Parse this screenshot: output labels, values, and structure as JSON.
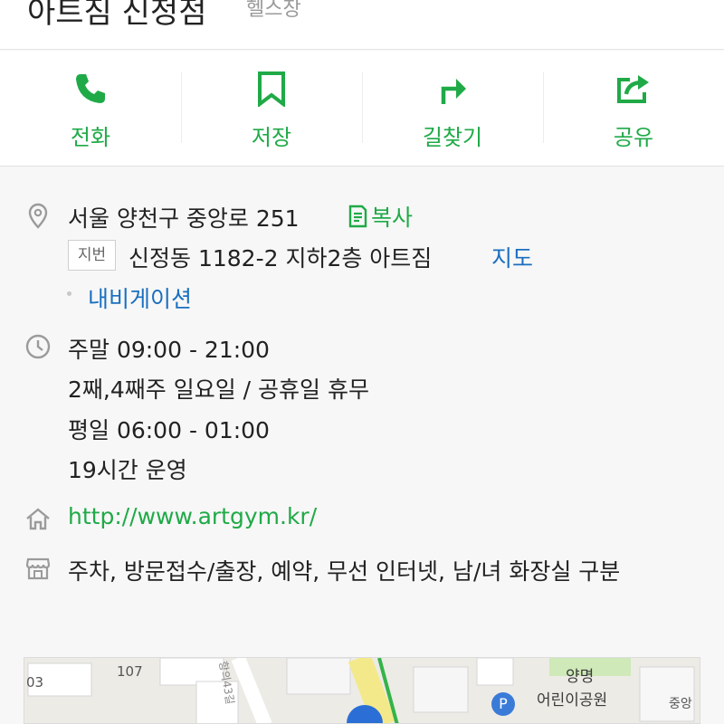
{
  "header": {
    "name": "아트짐 신정점",
    "category": "헬스장"
  },
  "actions": [
    {
      "label": "전화",
      "icon": "phone-icon"
    },
    {
      "label": "저장",
      "icon": "bookmark-icon"
    },
    {
      "label": "길찾기",
      "icon": "directions-icon"
    },
    {
      "label": "공유",
      "icon": "share-icon"
    }
  ],
  "address": {
    "road": "서울 양천구 중앙로 251",
    "copy_label": "복사",
    "jibun_tag": "지번",
    "jibun": "신정동 1182-2 지하2층 아트짐",
    "map_label": "지도",
    "navigation_label": "내비게이션"
  },
  "hours": {
    "weekend": "주말 09:00 - 21:00",
    "closed": "2째,4째주 일요일 / 공휴일 휴무",
    "weekday": "평일 06:00 - 01:00",
    "operation": "19시간 운영"
  },
  "website": "http://www.artgym.kr/",
  "amenities": "주차, 방문접수/출장, 예약, 무선 인터넷, 남/녀 화장실 구분",
  "map": {
    "labels": [
      "03",
      "107",
      "양명",
      "어린이공원",
      "중앙",
      "P",
      "항의43길"
    ]
  },
  "colors": {
    "accent_green": "#1faa47",
    "link_blue": "#1a6fc0",
    "icon_gray": "#9b9b9b"
  }
}
